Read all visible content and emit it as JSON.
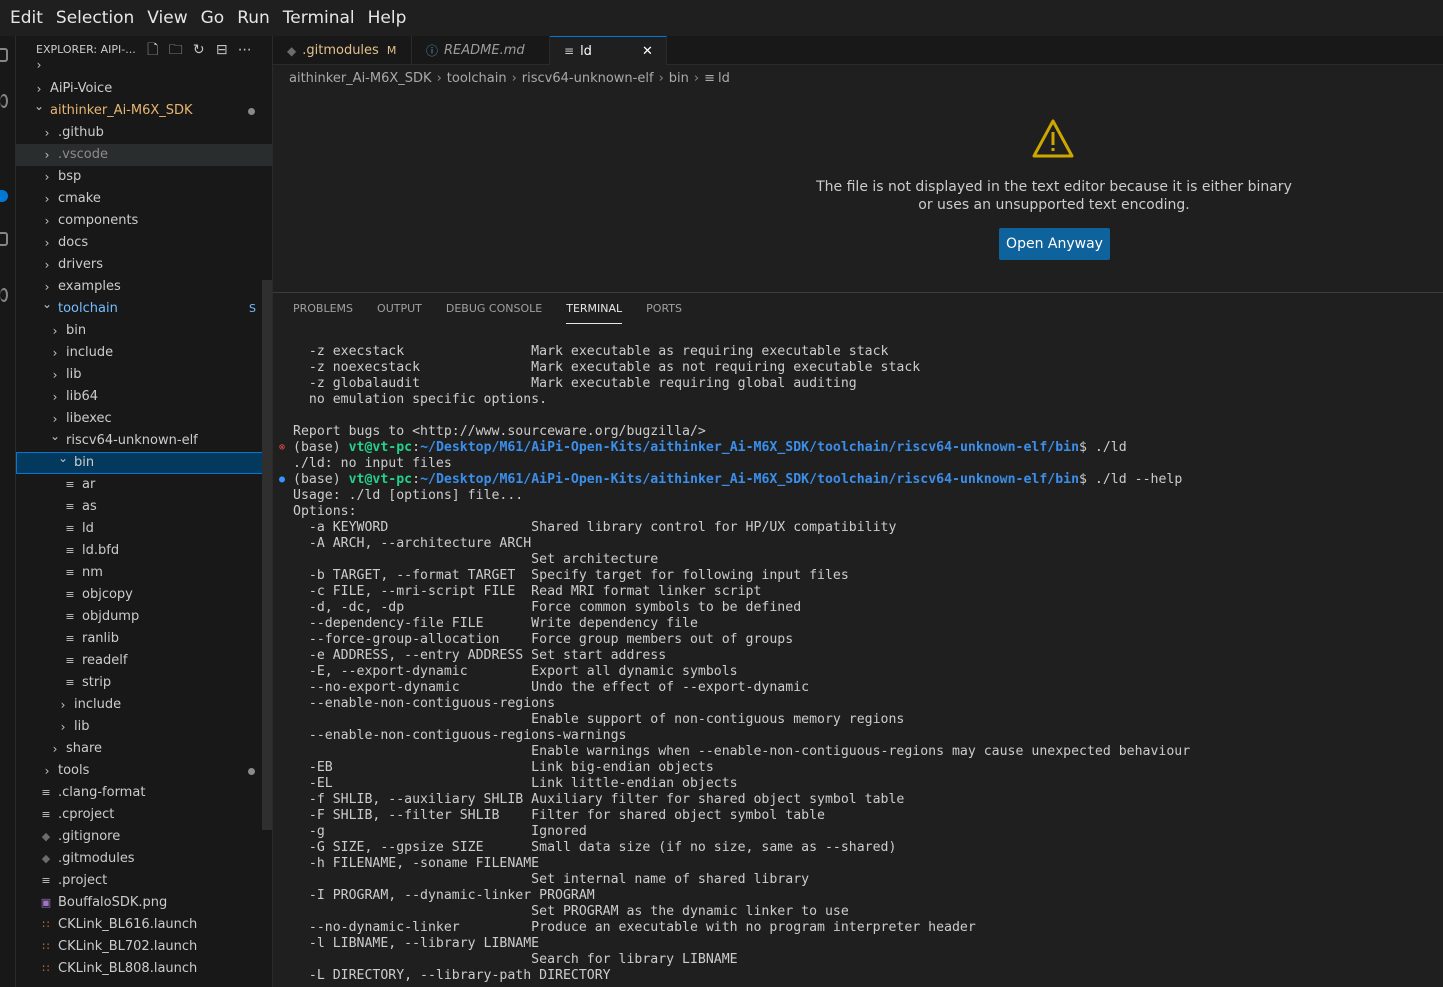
{
  "menubar": [
    "Edit",
    "Selection",
    "View",
    "Go",
    "Run",
    "Terminal",
    "Help"
  ],
  "explorer": {
    "title": "EXPLORER: AIPI-...",
    "items": [
      {
        "label": "AiPi-Voice",
        "type": "folder",
        "indent": 0
      },
      {
        "label": "aithinker_Ai-M6X_SDK",
        "type": "folder-open",
        "indent": 0,
        "status": "dot",
        "color": "orange"
      },
      {
        "label": ".github",
        "type": "folder",
        "indent": 1
      },
      {
        "label": ".vscode",
        "type": "folder",
        "indent": 1,
        "dim": true
      },
      {
        "label": "bsp",
        "type": "folder",
        "indent": 1
      },
      {
        "label": "cmake",
        "type": "folder",
        "indent": 1
      },
      {
        "label": "components",
        "type": "folder",
        "indent": 1
      },
      {
        "label": "docs",
        "type": "folder",
        "indent": 1
      },
      {
        "label": "drivers",
        "type": "folder",
        "indent": 1
      },
      {
        "label": "examples",
        "type": "folder",
        "indent": 1
      },
      {
        "label": "toolchain",
        "type": "folder-open",
        "indent": 1,
        "status": "S",
        "color": "blue"
      },
      {
        "label": "bin",
        "type": "folder",
        "indent": 2
      },
      {
        "label": "include",
        "type": "folder",
        "indent": 2
      },
      {
        "label": "lib",
        "type": "folder",
        "indent": 2
      },
      {
        "label": "lib64",
        "type": "folder",
        "indent": 2
      },
      {
        "label": "libexec",
        "type": "folder",
        "indent": 2
      },
      {
        "label": "riscv64-unknown-elf",
        "type": "folder-open",
        "indent": 2
      },
      {
        "label": "bin",
        "type": "folder-open",
        "indent": 3,
        "selected": true
      },
      {
        "label": "ar",
        "type": "file",
        "indent": 4
      },
      {
        "label": "as",
        "type": "file",
        "indent": 4
      },
      {
        "label": "ld",
        "type": "file",
        "indent": 4
      },
      {
        "label": "ld.bfd",
        "type": "file",
        "indent": 4
      },
      {
        "label": "nm",
        "type": "file",
        "indent": 4
      },
      {
        "label": "objcopy",
        "type": "file",
        "indent": 4
      },
      {
        "label": "objdump",
        "type": "file",
        "indent": 4
      },
      {
        "label": "ranlib",
        "type": "file",
        "indent": 4
      },
      {
        "label": "readelf",
        "type": "file",
        "indent": 4
      },
      {
        "label": "strip",
        "type": "file",
        "indent": 4
      },
      {
        "label": "include",
        "type": "folder",
        "indent": 3
      },
      {
        "label": "lib",
        "type": "folder",
        "indent": 3
      },
      {
        "label": "share",
        "type": "folder",
        "indent": 2
      },
      {
        "label": "tools",
        "type": "folder",
        "indent": 1,
        "status": "dot"
      },
      {
        "label": ".clang-format",
        "type": "file",
        "indent": 1
      },
      {
        "label": ".cproject",
        "type": "file",
        "indent": 1
      },
      {
        "label": ".gitignore",
        "type": "git",
        "indent": 1
      },
      {
        "label": ".gitmodules",
        "type": "git",
        "indent": 1
      },
      {
        "label": ".project",
        "type": "file",
        "indent": 1
      },
      {
        "label": "BouffaloSDK.png",
        "type": "image",
        "indent": 1
      },
      {
        "label": "CKLink_BL616.launch",
        "type": "rss",
        "indent": 1
      },
      {
        "label": "CKLink_BL702.launch",
        "type": "rss",
        "indent": 1
      },
      {
        "label": "CKLink_BL808.launch",
        "type": "rss",
        "indent": 1
      }
    ]
  },
  "tabs": [
    {
      "label": ".gitmodules",
      "flag": "M",
      "icon": "git-icon",
      "italic": false
    },
    {
      "label": "README.md",
      "flag": "",
      "icon": "info-icon",
      "italic": true
    },
    {
      "label": "ld",
      "flag": "",
      "icon": "file-lines-icon",
      "active": true,
      "close": "✕"
    }
  ],
  "breadcrumb": [
    "aithinker_Ai-M6X_SDK",
    "toolchain",
    "riscv64-unknown-elf",
    "bin",
    "ld"
  ],
  "editor": {
    "message": "The file is not displayed in the text editor because it is either binary or uses an unsupported text encoding.",
    "button": "Open Anyway"
  },
  "panel": {
    "tabs": [
      "PROBLEMS",
      "OUTPUT",
      "DEBUG CONSOLE",
      "TERMINAL",
      "PORTS"
    ],
    "active_tab": "TERMINAL"
  },
  "terminal": {
    "lines": [
      "  -z execstack                Mark executable as requiring executable stack",
      "  -z noexecstack              Mark executable as not requiring executable stack",
      "  -z globalaudit              Mark executable requiring global auditing",
      "  no emulation specific options.",
      "",
      "Report bugs to <http://www.sourceware.org/bugzilla/>",
      {
        "prompt": true,
        "mark": "err",
        "base": "(base) ",
        "user": "vt@vt-pc",
        "colon": ":",
        "path": "~/Desktop/M61/AiPi-Open-Kits/aithinker_Ai-M6X_SDK/toolchain/riscv64-unknown-elf/bin",
        "cmd": "$ ./ld"
      },
      "./ld: no input files",
      {
        "prompt": true,
        "mark": "ok",
        "base": "(base) ",
        "user": "vt@vt-pc",
        "colon": ":",
        "path": "~/Desktop/M61/AiPi-Open-Kits/aithinker_Ai-M6X_SDK/toolchain/riscv64-unknown-elf/bin",
        "cmd": "$ ./ld --help"
      },
      "Usage: ./ld [options] file...",
      "Options:",
      "  -a KEYWORD                  Shared library control for HP/UX compatibility",
      "  -A ARCH, --architecture ARCH",
      "                              Set architecture",
      "  -b TARGET, --format TARGET  Specify target for following input files",
      "  -c FILE, --mri-script FILE  Read MRI format linker script",
      "  -d, -dc, -dp                Force common symbols to be defined",
      "  --dependency-file FILE      Write dependency file",
      "  --force-group-allocation    Force group members out of groups",
      "  -e ADDRESS, --entry ADDRESS Set start address",
      "  -E, --export-dynamic        Export all dynamic symbols",
      "  --no-export-dynamic         Undo the effect of --export-dynamic",
      "  --enable-non-contiguous-regions",
      "                              Enable support of non-contiguous memory regions",
      "  --enable-non-contiguous-regions-warnings",
      "                              Enable warnings when --enable-non-contiguous-regions may cause unexpected behaviour",
      "  -EB                         Link big-endian objects",
      "  -EL                         Link little-endian objects",
      "  -f SHLIB, --auxiliary SHLIB Auxiliary filter for shared object symbol table",
      "  -F SHLIB, --filter SHLIB    Filter for shared object symbol table",
      "  -g                          Ignored",
      "  -G SIZE, --gpsize SIZE      Small data size (if no size, same as --shared)",
      "  -h FILENAME, -soname FILENAME",
      "                              Set internal name of shared library",
      "  -I PROGRAM, --dynamic-linker PROGRAM",
      "                              Set PROGRAM as the dynamic linker to use",
      "  --no-dynamic-linker         Produce an executable with no program interpreter header",
      "  -l LIBNAME, --library LIBNAME",
      "                              Search for library LIBNAME",
      "  -L DIRECTORY, --library-path DIRECTORY"
    ]
  },
  "colors": {
    "accent": "#0078d4",
    "button": "#0e639c",
    "warning": "#cca700",
    "prompt_user": "#23d18b",
    "prompt_path": "#3b8eea",
    "folder_highlight": "#75beff",
    "modified": "#e2c08d"
  }
}
